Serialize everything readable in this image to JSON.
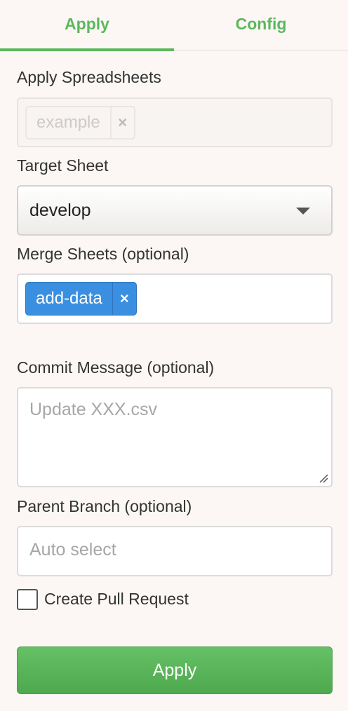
{
  "tabs": {
    "apply": "Apply",
    "config": "Config",
    "active": "apply"
  },
  "apply_spreadsheets": {
    "label": "Apply Spreadsheets",
    "tag": "example",
    "remove": "×"
  },
  "target_sheet": {
    "label": "Target Sheet",
    "value": "develop"
  },
  "merge_sheets": {
    "label": "Merge Sheets (optional)",
    "tag": "add-data",
    "remove": "×"
  },
  "commit_message": {
    "label": "Commit Message (optional)",
    "placeholder": "Update XXX.csv"
  },
  "parent_branch": {
    "label": "Parent Branch (optional)",
    "placeholder": "Auto select"
  },
  "pull_request": {
    "label": "Create Pull Request",
    "checked": false
  },
  "submit": {
    "label": "Apply"
  },
  "colors": {
    "accent": "#5cb85c",
    "tag_blue": "#3a8fe0",
    "background": "#fcf7f5"
  }
}
